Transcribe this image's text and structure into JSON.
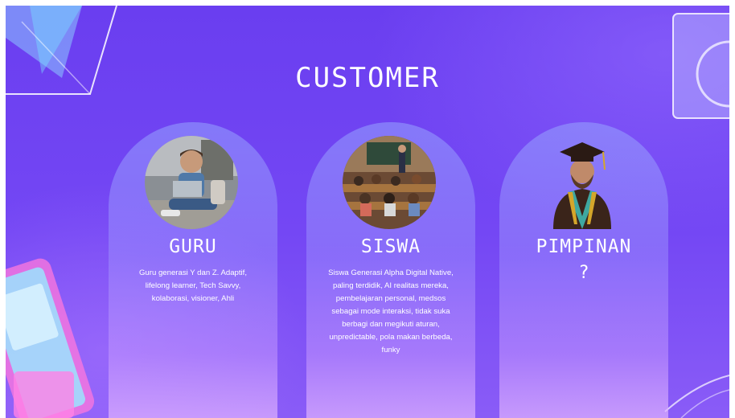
{
  "slide": {
    "title": "CUSTOMER"
  },
  "cards": [
    {
      "title": "GURU",
      "text": "Guru generasi Y dan Z. Adaptif, lifelong learner, Tech Savvy, kolaborasi, visioner, Ahli"
    },
    {
      "title": "SISWA",
      "text": "Siswa Generasi Alpha Digital Native, paling terdidik, AI realitas mereka, pembelajaran personal, medsos sebagai mode interaksi, tidak suka berbagi dan megikuti aturan, unpredictable, pola makan berbeda, funky"
    },
    {
      "title": "PIMPINAN",
      "text": "?"
    }
  ]
}
